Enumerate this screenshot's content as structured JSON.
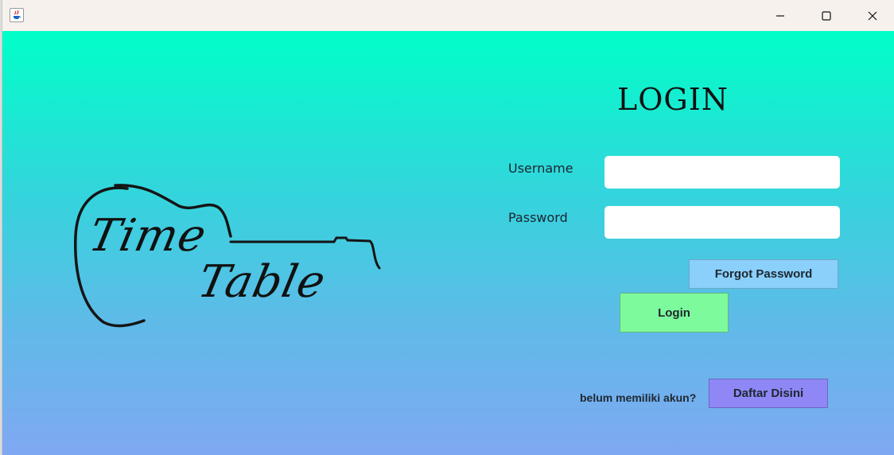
{
  "window": {
    "icon": "java-icon",
    "controls": {
      "minimize": "minimize-icon",
      "maximize": "maximize-icon",
      "close": "close-icon"
    }
  },
  "logo": {
    "line1": "Time",
    "line2": "Table",
    "icon": "guitar-outline-icon"
  },
  "login": {
    "title": "LOGIN",
    "username_label": "Username",
    "username_value": "",
    "password_label": "Password",
    "password_value": "",
    "forgot_password_label": "Forgot Password",
    "login_button_label": "Login"
  },
  "register": {
    "prompt": "belum memiliki akun?",
    "button_label": "Daftar Disini"
  },
  "colors": {
    "gradient_top": "#00ffc8",
    "gradient_bottom": "#80a8f2",
    "forgot_button": "#8ad0fb",
    "login_button": "#7dfa9c",
    "register_button": "#8e87f5"
  }
}
